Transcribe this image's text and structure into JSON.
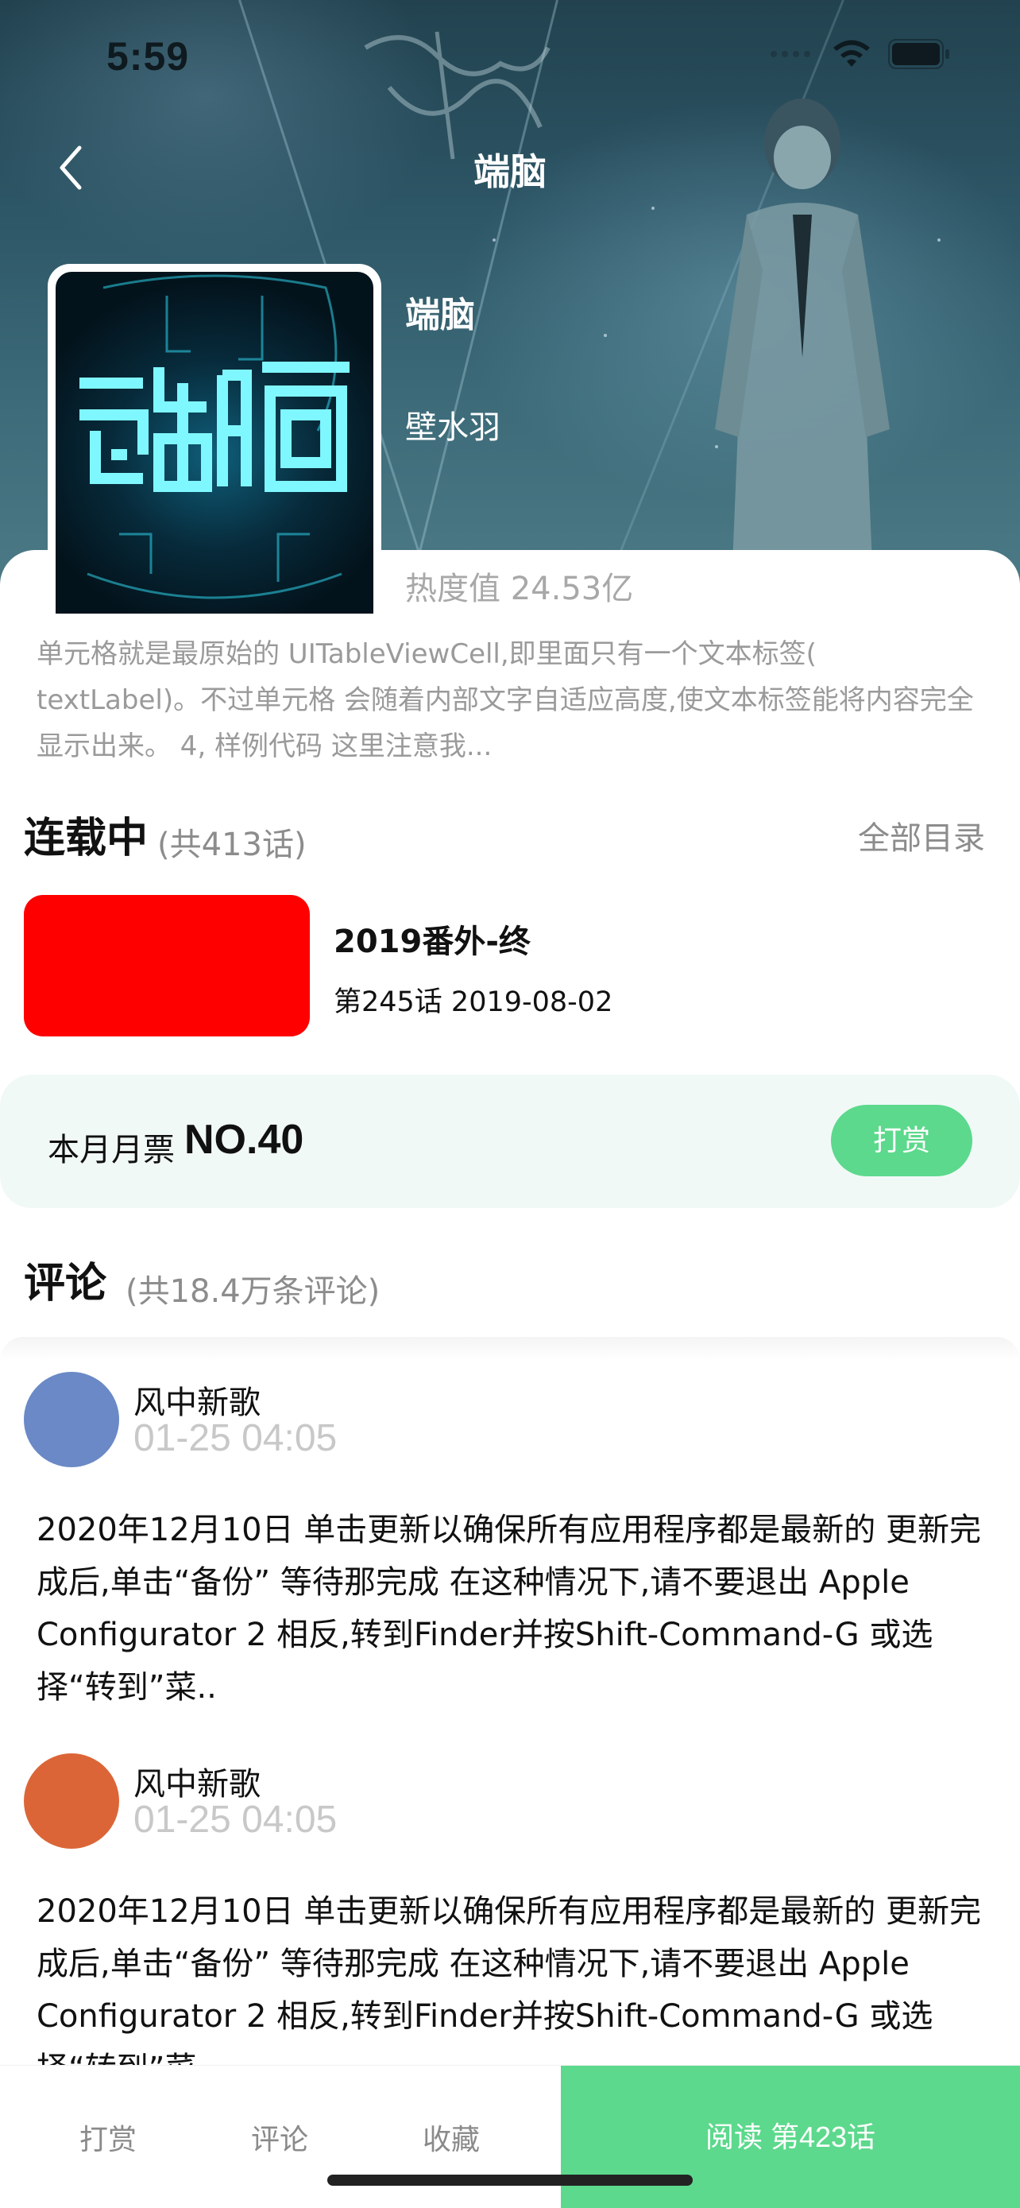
{
  "status_bar": {
    "time": "5:59"
  },
  "nav": {
    "title": "端脑"
  },
  "book": {
    "title": "端脑",
    "author": "壁水羽",
    "hotness": "热度值 24.53亿",
    "intro": "单元格就是最原始的 UITableViewCell,即里面只有一个文本标签( textLabel)。不过单元格 会随着内部文字自适应高度,使文本标签能将内容完全显示出来。 4, 样例代码 这里注意我..."
  },
  "serial": {
    "status": "连载中",
    "count": "(共413话)",
    "all_chapters": "全部目录",
    "latest_title": "2019番外-终",
    "latest_meta": "第245话 2019-08-02",
    "thumb_color": "#ff0000"
  },
  "monthly_ticket": {
    "label": "本月月票",
    "rank": "NO.40",
    "reward_button": "打赏"
  },
  "comments_header": {
    "title": "评论",
    "count": "(共18.4万条评论)"
  },
  "comments": [
    {
      "user": "风中新歌",
      "time": "01-25  04:05",
      "avatar_color": "#6a89c6",
      "text": "2020年12月10日 单击更新以确保所有应用程序都是最新的 更新完成后,单击“备份” 等待那完成 在这种情况下,请不要退出 Apple Configurator 2 相反,转到Finder并按Shift-Command-G 或选择“转到”菜.."
    },
    {
      "user": "风中新歌",
      "time": "01-25  04:05",
      "avatar_color": "#dc6537",
      "text": "2020年12月10日 单击更新以确保所有应用程序都是最新的 更新完成后,单击“备份” 等待那完成 在这种情况下,请不要退出 Apple Configurator 2 相反,转到Finder并按Shift-Command-G 或选择“转到”菜.."
    }
  ],
  "bottom_bar": {
    "tabs": [
      "打赏",
      "评论",
      "收藏"
    ],
    "read_button": "阅读 第423话"
  },
  "colors": {
    "accent": "#5cd98c",
    "ticket_bg": "#f1f9f7"
  }
}
